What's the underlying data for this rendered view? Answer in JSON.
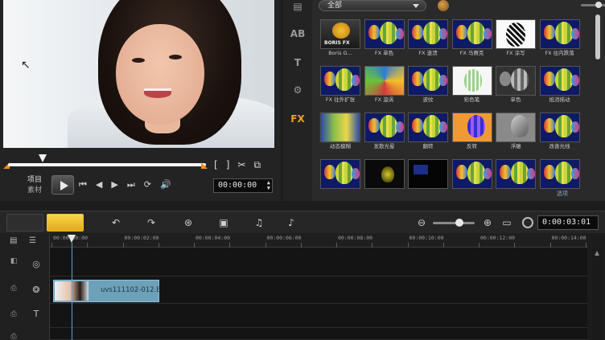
{
  "preview": {
    "mode_project": "项目",
    "mode_clip": "素材",
    "timecode": "00:00:00",
    "trim_in": "[",
    "trim_out": "]"
  },
  "library": {
    "category": "全部",
    "footer": "选项",
    "items": [
      {
        "label": "Boris G...",
        "variant": "boris"
      },
      {
        "label": "FX 单色",
        "variant": "balloon"
      },
      {
        "label": "FX 速溃",
        "variant": "balloon"
      },
      {
        "label": "FX 马赛克",
        "variant": "balloon"
      },
      {
        "label": "FX 涂写",
        "variant": "bw"
      },
      {
        "label": "FX 往内跌落",
        "variant": "balloon"
      },
      {
        "label": "FX 往外扩张",
        "variant": "balloon"
      },
      {
        "label": "FX 漩涡",
        "variant": "swirl"
      },
      {
        "label": "波纹",
        "variant": "balloon"
      },
      {
        "label": "彩色笔",
        "variant": "sketch"
      },
      {
        "label": "单色",
        "variant": "mono"
      },
      {
        "label": "抵消摇动",
        "variant": "balloon"
      },
      {
        "label": "动态模糊",
        "variant": "blur"
      },
      {
        "label": "发散光晕",
        "variant": "balloon"
      },
      {
        "label": "翻转",
        "variant": "balloon"
      },
      {
        "label": "反转",
        "variant": "invert"
      },
      {
        "label": "浮雕",
        "variant": "emboss"
      },
      {
        "label": "改善光线",
        "variant": "balloon"
      },
      {
        "label": "",
        "variant": "balloon"
      },
      {
        "label": "",
        "variant": "dark"
      },
      {
        "label": "",
        "variant": "dark2"
      },
      {
        "label": "",
        "variant": "balloon"
      },
      {
        "label": "",
        "variant": "balloon"
      },
      {
        "label": "",
        "variant": "balloon"
      }
    ]
  },
  "timeline": {
    "total_time": "0:00:03:01",
    "ruler": [
      "00:00:00:00",
      "00:00:02:00",
      "00:00:04:00",
      "00:00:06:00",
      "00:00:08:00",
      "00:00:10:00",
      "00:00:12:00",
      "00:00:14:00"
    ],
    "clip_name": "uvs111102-012.E"
  },
  "colors": {
    "accent": "#f0a020",
    "clip": "#6da1b9",
    "playhead": "#62a6d6"
  }
}
